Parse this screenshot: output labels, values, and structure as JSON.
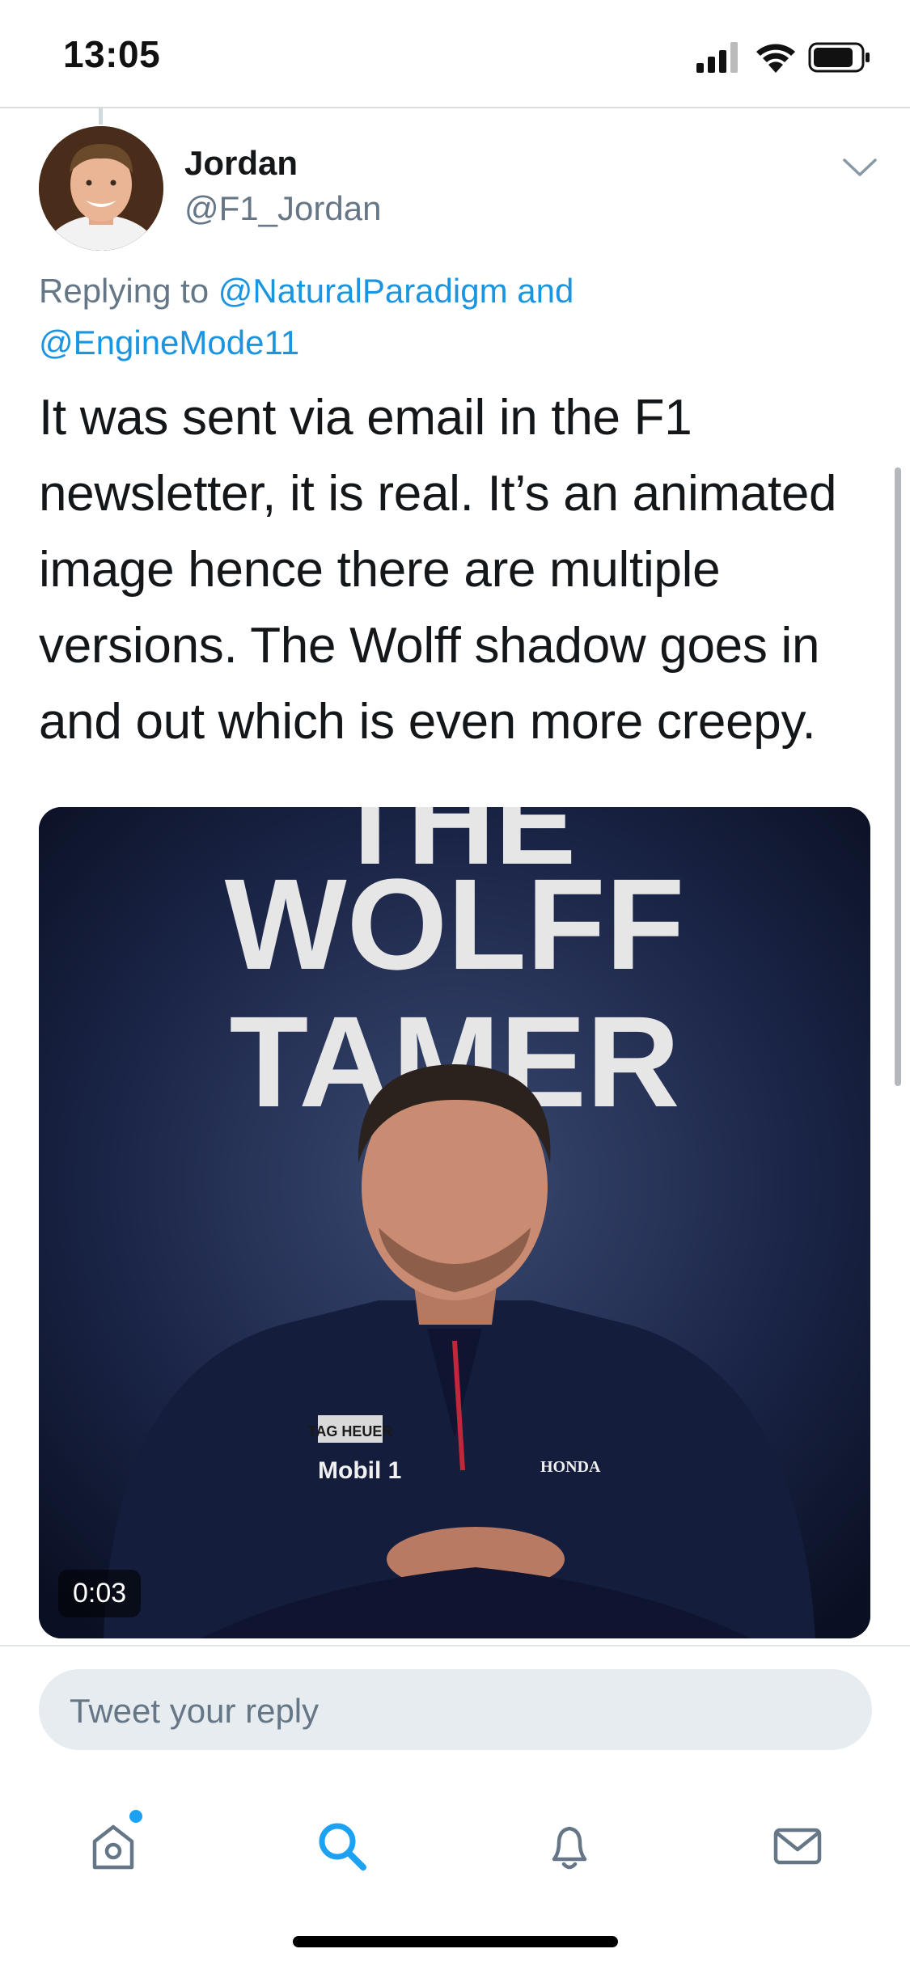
{
  "status_bar": {
    "time": "13:05",
    "icons": [
      "signal-icon",
      "wifi-icon",
      "battery-icon"
    ]
  },
  "tweet": {
    "author_name": "Jordan",
    "author_handle": "@F1_Jordan",
    "replying_prefix": "Replying to ",
    "replying_mention_1": "@NaturalParadigm",
    "replying_and": " and",
    "replying_mention_2": "@EngineMode11",
    "text": "It was sent via email in the F1 newsletter, it is real. It’s an animated image hence there are multiple versions. The Wolff shadow goes in and out which is even more creepy.",
    "media": {
      "poster_text_line_1": "THE",
      "poster_text_line_2": "WOLFF",
      "poster_text_line_3": "TAMER",
      "duration": "0:03",
      "shirt_logos": [
        "TAG HEUER",
        "Mobil 1",
        "HONDA"
      ]
    }
  },
  "reply_bar": {
    "placeholder": "Tweet your reply"
  },
  "tab_bar": {
    "tabs": [
      "home-icon",
      "search-icon",
      "notifications-icon",
      "messages-icon"
    ],
    "active": "search-icon"
  },
  "colors": {
    "accent": "#1da1f2",
    "link": "#1b95e0",
    "muted": "#657786",
    "text": "#14171a"
  }
}
